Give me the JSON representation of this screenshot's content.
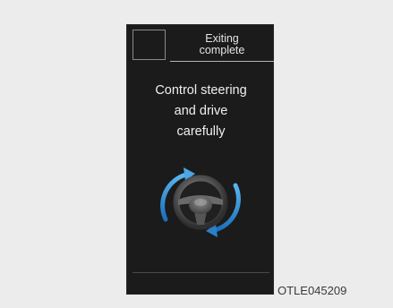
{
  "display": {
    "status": {
      "line1": "Exiting",
      "line2": "complete"
    },
    "instruction": {
      "line1": "Control steering",
      "line2": "and drive",
      "line3": "carefully"
    },
    "icon": "steering-wheel-icon",
    "arrow_color": "#2f8fd6",
    "background": "#1b1b1b"
  },
  "figure_code": "OTLE045209"
}
